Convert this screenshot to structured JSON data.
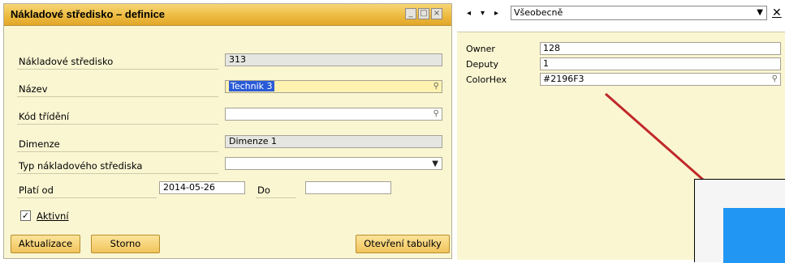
{
  "window": {
    "title": "Nákladové středisko – definice"
  },
  "form": {
    "cost_center": {
      "label": "Nákladové středisko",
      "value": "313"
    },
    "name": {
      "label": "Název",
      "value": "Technik 3"
    },
    "sort_code": {
      "label": "Kód třídění",
      "value": ""
    },
    "dimension": {
      "label": "Dimenze",
      "value": "Dimenze 1"
    },
    "cc_type": {
      "label": "Typ nákladového střediska",
      "value": ""
    },
    "valid_from": {
      "label": "Platí od",
      "value": "2014-05-26"
    },
    "valid_to": {
      "label": "Do",
      "value": ""
    },
    "active": {
      "label": "Aktivní",
      "checked": true
    }
  },
  "buttons": {
    "update": "Aktualizace",
    "cancel": "Storno",
    "open_table": "Otevření tabulky"
  },
  "udf": {
    "category": "Všeobecně",
    "close_glyph": "✕",
    "fields": [
      {
        "label": "Owner",
        "value": "128"
      },
      {
        "label": "Deputy",
        "value": "1"
      },
      {
        "label": "ColorHex",
        "value": "#2196F3"
      }
    ]
  },
  "colors": {
    "swatch": "#2196F3",
    "arrow": "#c0282a"
  }
}
